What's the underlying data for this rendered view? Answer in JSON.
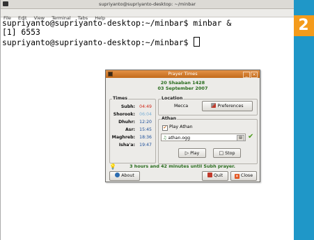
{
  "badge": "2",
  "terminal": {
    "title": "supriyanto@supriyanto-desktop: ~/minbar",
    "menu": [
      "File",
      "Edit",
      "View",
      "Terminal",
      "Tabs",
      "Help"
    ],
    "lines": [
      "supriyanto@supriyanto-desktop:~/minbar$ minbar &",
      "[1] 6553",
      "supriyanto@supriyanto-desktop:~/minbar$ "
    ]
  },
  "dialog": {
    "title": "Prayer Times",
    "hijri_date": "20 Shaaban 1428",
    "gregorian_date": "03 September 2007",
    "times_title": "Times",
    "times": [
      {
        "name": "Subh:",
        "time": "04:49",
        "color": "#d0281a"
      },
      {
        "name": "Shorook:",
        "time": "06:04",
        "color": "#7ab0d6"
      },
      {
        "name": "Dhuhr:",
        "time": "12:20",
        "color": "#1d4f9a"
      },
      {
        "name": "Asr:",
        "time": "15:45",
        "color": "#1d4f9a"
      },
      {
        "name": "Maghreb:",
        "time": "18:36",
        "color": "#1d4f9a"
      },
      {
        "name": "Isha'a:",
        "time": "19:47",
        "color": "#1d4f9a"
      }
    ],
    "location_title": "Location",
    "location_value": "Mecca",
    "preferences_label": "Preferences",
    "athan_title": "Athan",
    "play_athan_label": "Play Athan",
    "play_athan_checked": true,
    "athan_file": "athan.ogg",
    "play_label": "Play",
    "stop_label": "Stop",
    "status_text": "3 hours and 42 minutes until Subh prayer.",
    "about_label": "About",
    "quit_label": "Quit",
    "close_label": "Close"
  }
}
